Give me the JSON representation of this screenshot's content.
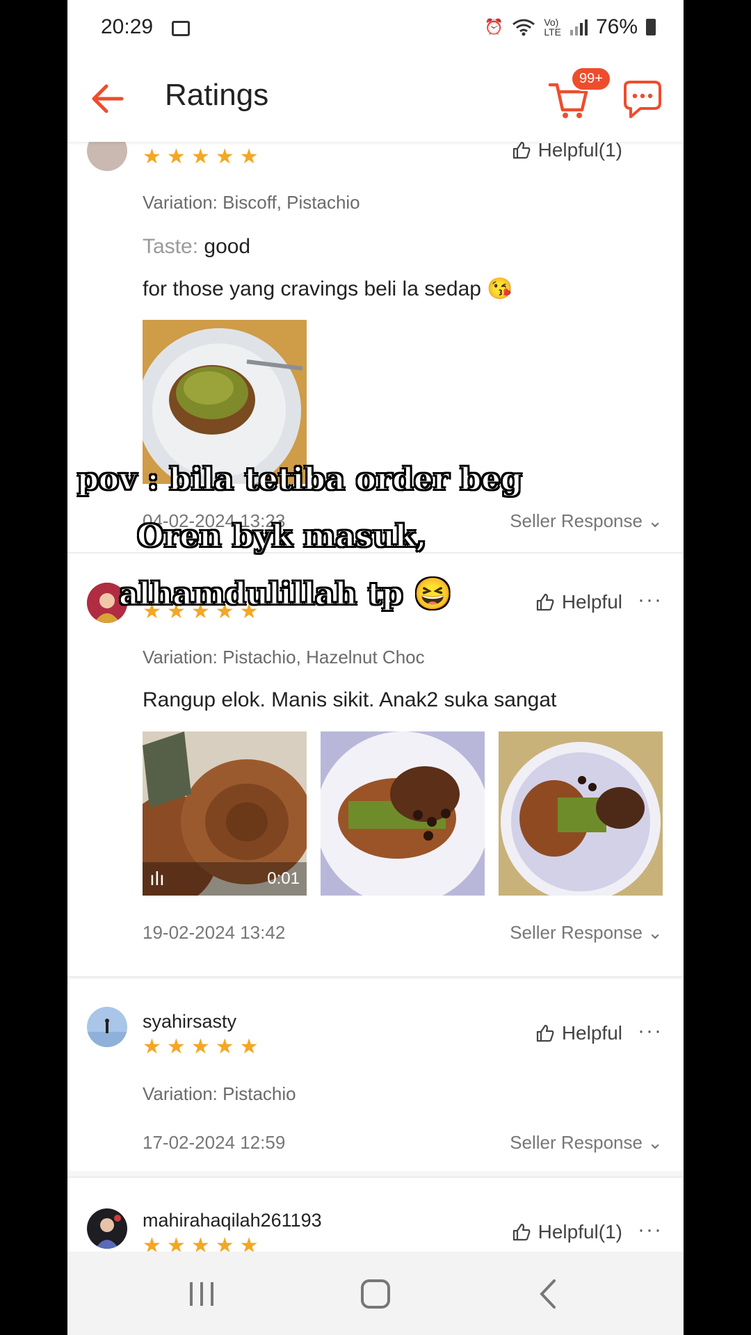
{
  "status_bar": {
    "time": "20:29",
    "battery": "76%",
    "icons": [
      "image-icon",
      "alarm-icon",
      "wifi-icon",
      "volte-icon",
      "signal-icon",
      "battery-icon"
    ]
  },
  "header": {
    "title": "Ratings",
    "cart_badge": "99+",
    "accent_color": "#ee4d2d"
  },
  "reviews": [
    {
      "helpful": "Helpful(1)",
      "variation": "Variation: Biscoff, Pistachio",
      "taste_label": "Taste:",
      "taste_value": " good",
      "text": "for those yang cravings beli la sedap 😘",
      "date": "04-02-2024 13:23",
      "seller_response": "Seller Response",
      "rating": 5
    },
    {
      "helpful": "Helpful",
      "variation": "Variation: Pistachio, Hazelnut Choc",
      "text": "Rangup elok. Manis sikit. Anak2 suka sangat",
      "video_duration": "0:01",
      "date": "19-02-2024 13:42",
      "seller_response": "Seller Response",
      "rating": 5
    },
    {
      "username": "syahirsasty",
      "helpful": "Helpful",
      "variation": "Variation: Pistachio",
      "date": "17-02-2024 12:59",
      "seller_response": "Seller Response",
      "rating": 5
    },
    {
      "username": "mahirahaqilah261193",
      "helpful": "Helpful(1)",
      "rating": 5
    }
  ],
  "overlay_caption": {
    "line1": "pov : bila tetiba order beg",
    "line2": "Oren byk masuk,",
    "line3": "alhamdulillah tp 😆"
  },
  "stars_glyph": "★ ★ ★ ★ ★",
  "more_glyph": "···"
}
